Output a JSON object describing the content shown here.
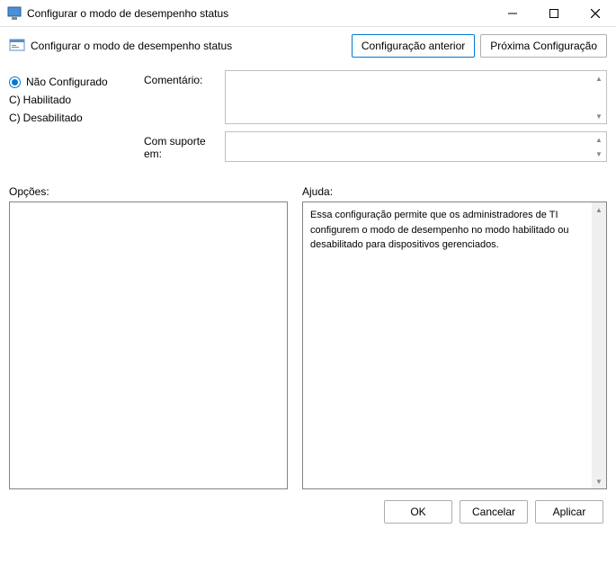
{
  "window": {
    "title": "Configurar o modo de desempenho status"
  },
  "header": {
    "title": "Configurar o modo de desempenho status",
    "prev": "Configuração anterior",
    "next": "Próxima Configuração"
  },
  "state": {
    "not_configured": "Não Configurado",
    "enabled": "Habilitado",
    "disabled": "Desabilitado",
    "prefix": "C)"
  },
  "fields": {
    "comment_label": "Comentário:",
    "comment_value": "",
    "supported_label": "Com suporte em:",
    "supported_value": ""
  },
  "sections": {
    "options_label": "Opções:",
    "help_label": "Ajuda:"
  },
  "help": {
    "line1": "Essa configuração permite que os administradores de TI configurem o modo de desempenho",
    "line2": "no modo habilitado ou desabilitado para dispositivos gerenciados."
  },
  "buttons": {
    "ok": "OK",
    "cancel": "Cancelar",
    "apply": "Aplicar"
  }
}
